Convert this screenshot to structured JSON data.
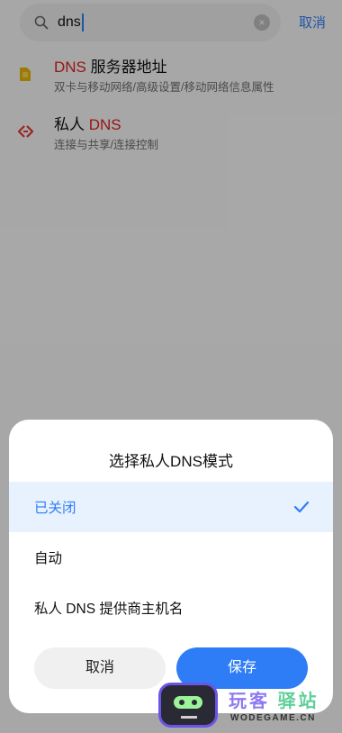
{
  "search": {
    "query": "dns",
    "clear_icon": "clear-icon",
    "cancel_label": "取消"
  },
  "results": [
    {
      "icon": "sim-card-icon",
      "title_highlight": "DNS",
      "title_rest": " 服务器地址",
      "subtitle": "双卡与移动网络/高级设置/移动网络信息属性"
    },
    {
      "icon": "private-dns-icon",
      "title_prefix": "私人 ",
      "title_highlight": "DNS",
      "subtitle": "连接与共享/连接控制"
    }
  ],
  "dialog": {
    "title": "选择私人DNS模式",
    "options": [
      {
        "label": "已关闭",
        "selected": true
      },
      {
        "label": "自动",
        "selected": false
      },
      {
        "label": "私人 DNS 提供商主机名",
        "selected": false
      }
    ],
    "cancel_label": "取消",
    "save_label": "保存"
  },
  "watermark": {
    "cn_part1": "玩客",
    "cn_part2": "驿站",
    "en": "WODEGAME.CN"
  },
  "colors": {
    "accent": "#2f7df6",
    "highlight": "#e02020",
    "selected_bg": "#e8f1fe"
  }
}
